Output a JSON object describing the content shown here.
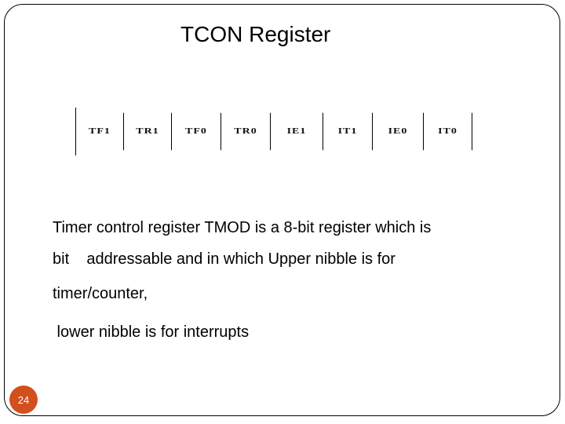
{
  "slide": {
    "title": "TCON Register",
    "register_bits": [
      "TF1",
      "TR1",
      "TF0",
      "TR0",
      "IE1",
      "IT1",
      "IE0",
      "IT0"
    ],
    "body_lines": [
      "Timer control register TMOD is a 8-bit register which is",
      "bit    addressable and in which Upper nibble is for",
      "timer/counter,",
      " lower nibble is for interrupts"
    ],
    "slide_number": "24",
    "accent_color": "#d24f1e"
  }
}
